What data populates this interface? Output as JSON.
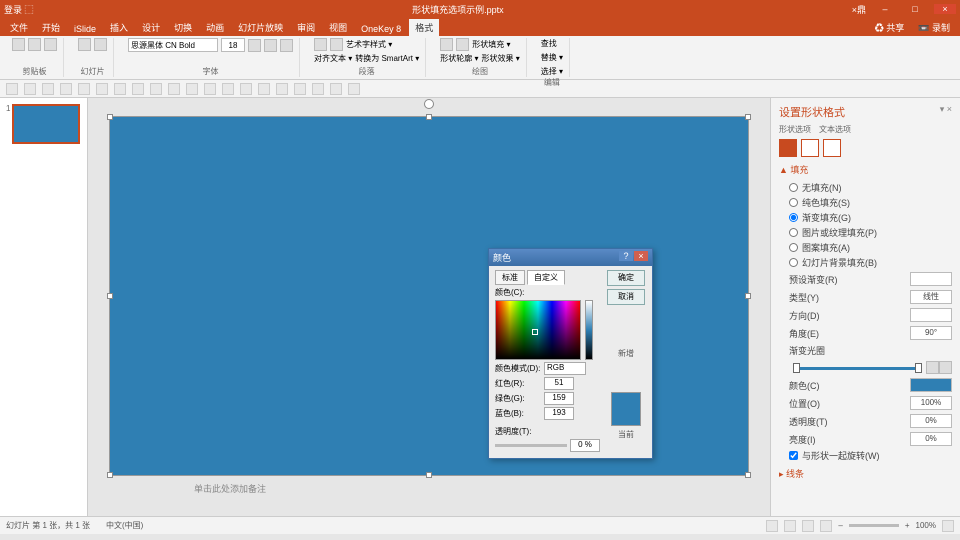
{
  "titlebar": {
    "left": "登录 ⬚",
    "center_file": "形状填充选项示例.pptx",
    "user": "×鼎",
    "min": "–",
    "max": "□",
    "close": "×"
  },
  "tabs": [
    "文件",
    "开始",
    "iSlide",
    "插入",
    "设计",
    "切换",
    "动画",
    "幻灯片放映",
    "审阅",
    "视图",
    "OneKey 8",
    "格式"
  ],
  "active_tab": 11,
  "extra_tabs": {
    "share": "♻ 共享",
    "rec": "📼 录制"
  },
  "ribbon": {
    "g1": "剪贴板",
    "g2": "幻灯片",
    "g3": "字体",
    "g4": "段落",
    "g5": "绘图",
    "g6": "编辑",
    "font": "思源黑体 CN Bold",
    "size": "18",
    "wordart": "艺术字样式 ▾",
    "align": "对齐文本 ▾",
    "smart": "转换为 SmartArt ▾",
    "shfill": "形状填充 ▾",
    "shout": "形状轮廓 ▾",
    "shfx": "形状效果 ▾",
    "find": "查找",
    "repl": "替换 ▾",
    "sel": "选择 ▾"
  },
  "thumb_idx": "1",
  "note": "单击此处添加备注",
  "panel": {
    "title": "设置形状格式",
    "sub1": "形状选项",
    "sub2": "文本选项",
    "sect_fill": "▲ 填充",
    "opts": [
      "无填充(N)",
      "纯色填充(S)",
      "渐变填充(G)",
      "图片或纹理填充(P)",
      "图案填充(A)",
      "幻灯片背景填充(B)"
    ],
    "opt_sel": 2,
    "preset": "预设渐变(R)",
    "type": "类型(Y)",
    "type_v": "线性",
    "dir": "方向(D)",
    "angle": "角度(E)",
    "angle_v": "90°",
    "stops": "渐变光圈",
    "color": "颜色(C)",
    "pos": "位置(O)",
    "pos_v": "100%",
    "trans": "透明度(T)",
    "trans_v": "0%",
    "bright": "亮度(I)",
    "bright_v": "0%",
    "rotate": "与形状一起旋转(W)",
    "sect_line": "▸ 线条"
  },
  "dialog": {
    "title": "颜色",
    "tab1": "标准",
    "tab2": "自定义",
    "colors": "颜色(C):",
    "ok": "确定",
    "cancel": "取消",
    "mode": "颜色模式(D):",
    "mode_v": "RGB",
    "r": "红色(R):",
    "r_v": "51",
    "g": "绿色(G):",
    "g_v": "159",
    "b": "蓝色(B):",
    "b_v": "193",
    "trans": "透明度(T):",
    "trans_v": "0 %",
    "new": "新增",
    "cur": "当前"
  },
  "status": {
    "l1": "幻灯片 第 1 张，共 1 张",
    "l2": "中文(中国)",
    "zoom": "100%"
  }
}
